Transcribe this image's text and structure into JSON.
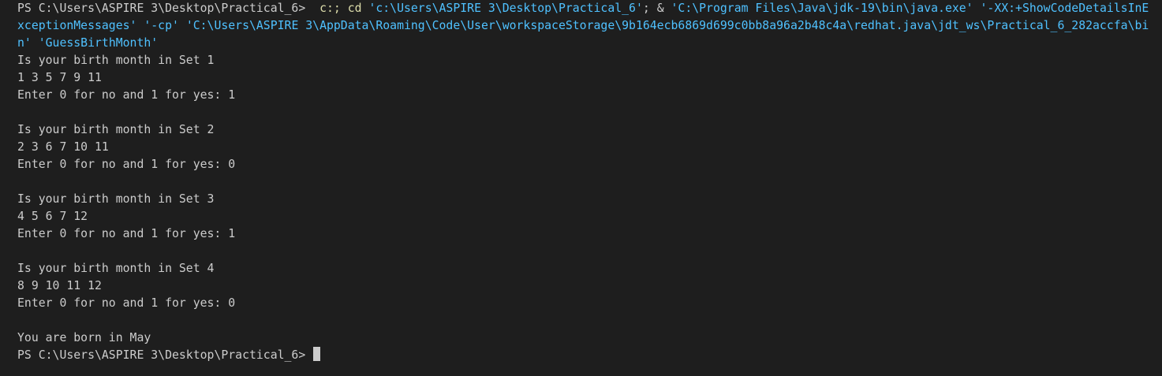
{
  "terminal": {
    "cmd": {
      "prompt": "PS C:\\Users\\ASPIRE 3\\Desktop\\Practical_6> ",
      "c_colon": " c:; ",
      "cd": "cd",
      "cd_path": " 'c:\\Users\\ASPIRE 3\\Desktop\\Practical_6'",
      "sep": "; & ",
      "java_exe": "'C:\\Program Files\\Java\\jdk-19\\bin\\java.exe'",
      "xx_flag_a": " '-XX:+ShowCodeDetailsInE",
      "xx_flag_b": "xceptionMessages'",
      "cp_flag": " '-cp' ",
      "cp_path_a": "'C:\\Users\\ASPIRE 3\\AppData\\Roaming\\Code\\User\\workspaceStorage\\9b164ecb6869d699c0bb8a96a2b48c4a\\redhat.java\\jdt_ws\\Practical_6_282accfa\\bi",
      "cp_path_b": "n'",
      "main_class": " 'GuessBirthMonth'"
    },
    "output": {
      "set1_q": "Is your birth month in Set 1",
      "set1_nums": "1 3 5 7 9 11",
      "set1_prompt": "Enter 0 for no and 1 for yes: 1",
      "set2_q": "Is your birth month in Set 2",
      "set2_nums": "2 3 6 7 10 11",
      "set2_prompt": "Enter 0 for no and 1 for yes: 0",
      "set3_q": "Is your birth month in Set 3",
      "set3_nums": "4 5 6 7 12",
      "set3_prompt": "Enter 0 for no and 1 for yes: 1",
      "set4_q": "Is your birth month in Set 4",
      "set4_nums": "8 9 10 11 12",
      "set4_prompt": "Enter 0 for no and 1 for yes: 0",
      "result": "You are born in May"
    },
    "final_prompt": "PS C:\\Users\\ASPIRE 3\\Desktop\\Practical_6> "
  }
}
